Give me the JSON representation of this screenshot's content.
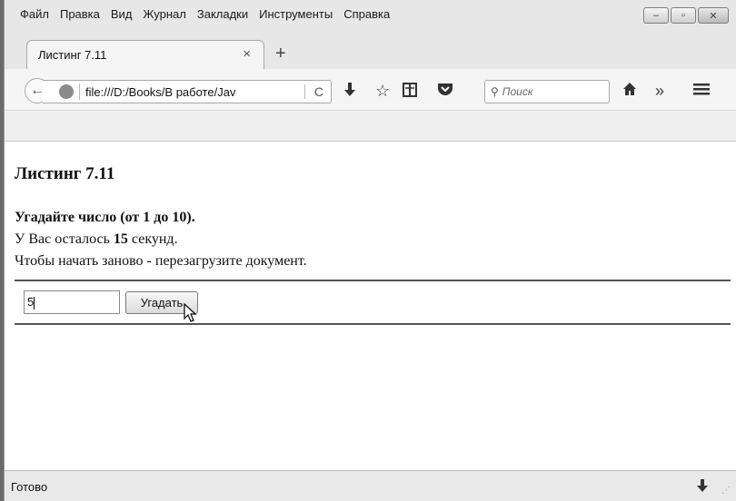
{
  "menu": {
    "items": [
      "Файл",
      "Правка",
      "Вид",
      "Журнал",
      "Закладки",
      "Инструменты",
      "Справка"
    ]
  },
  "window_controls": {
    "minimize": "–",
    "maximize": "▫",
    "close": "✕"
  },
  "tab": {
    "title": "Листинг 7.11",
    "close": "×",
    "new_tab": "+"
  },
  "navbar": {
    "back": "←",
    "url": "file:///D:/Books/В работе/Jav",
    "reload": "C",
    "search_placeholder": "Поиск",
    "search_icon": "search-icon",
    "download_icon": "download-icon",
    "bookmark_icon": "star-icon",
    "reading_list_icon": "reading-list-icon",
    "pocket_icon": "pocket-icon",
    "home_icon": "home-icon",
    "overflow_icon": "chevron-double-right-icon",
    "menu_icon": "hamburger-icon"
  },
  "page": {
    "heading": "Листинг 7.11",
    "guess_prompt": "Угадайте число (от 1 до 10).",
    "time_prefix": "У Вас осталось ",
    "time_value": "15",
    "time_suffix": " секунд.",
    "restart_hint": "Чтобы начать заново - перезагрузите документ.",
    "input_value": "5",
    "button_label": "Угадать"
  },
  "status": {
    "text": "Готово"
  }
}
